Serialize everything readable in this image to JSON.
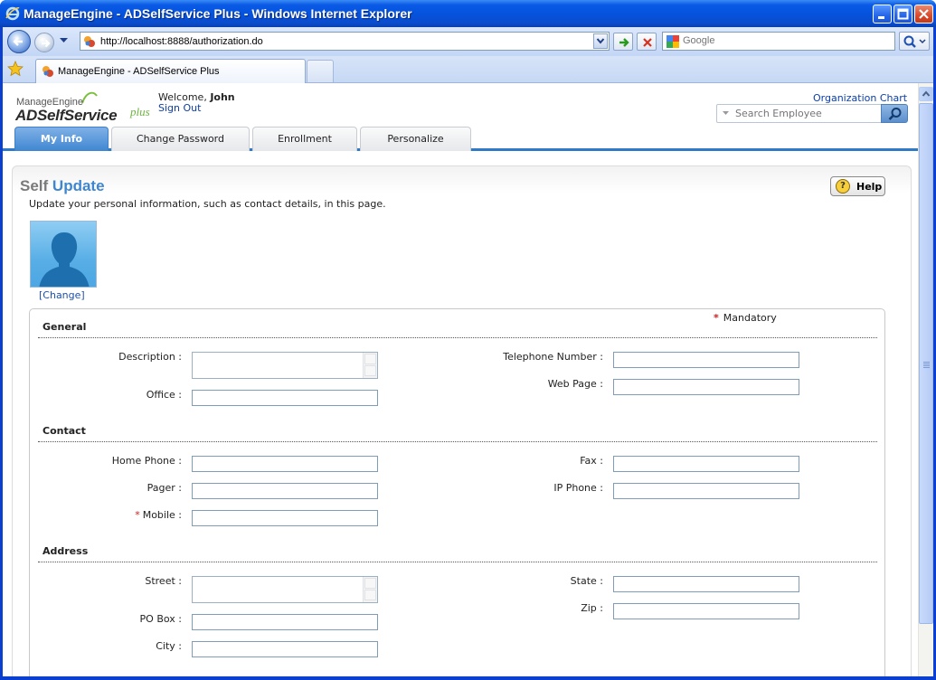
{
  "window": {
    "title": "ManageEngine - ADSelfService Plus - Windows Internet Explorer"
  },
  "browser": {
    "address": "http://localhost:8888/authorization.do",
    "search_placeholder": "Google",
    "tab_title": "ManageEngine - ADSelfService Plus"
  },
  "app": {
    "logo_top": "ManageEngine",
    "logo_main": "ADSelfService",
    "logo_plus": "plus",
    "welcome_prefix": "Welcome,",
    "user_name": "John",
    "sign_out": "Sign Out",
    "org_chart": "Organization Chart",
    "search_placeholder": "Search Employee",
    "tabs": [
      {
        "label": "My Info",
        "active": true
      },
      {
        "label": "Change Password",
        "active": false
      },
      {
        "label": "Enrollment",
        "active": false
      },
      {
        "label": "Personalize",
        "active": false
      }
    ]
  },
  "page": {
    "title_a": "Self",
    "title_b": "Update",
    "description": "Update your personal information, such as contact details, in this page.",
    "help_label": "Help",
    "help_glyph": "?",
    "avatar_change": "[Change]",
    "mandatory_label": "Mandatory",
    "mandatory_marker": "*"
  },
  "form": {
    "sections": {
      "general": "General",
      "contact": "Contact",
      "address": "Address"
    },
    "labels": {
      "description": "Description :",
      "office": "Office :",
      "telephone": "Telephone Number :",
      "web_page": "Web Page :",
      "home_phone": "Home Phone :",
      "pager": "Pager :",
      "mobile": "Mobile :",
      "mobile_req": "*",
      "fax": "Fax :",
      "ip_phone": "IP Phone :",
      "street": "Street :",
      "po_box": "PO Box :",
      "city": "City :",
      "state": "State :",
      "zip": "Zip :"
    },
    "values": {
      "office": "",
      "telephone": "",
      "web_page": "",
      "home_phone": "",
      "pager": "",
      "mobile": "",
      "fax": "",
      "ip_phone": "",
      "po_box": "",
      "city": "",
      "state": "",
      "zip": ""
    }
  },
  "colors": {
    "accent": "#3f86cf",
    "required": "#cc1f1f",
    "link": "#0b3ea8"
  }
}
